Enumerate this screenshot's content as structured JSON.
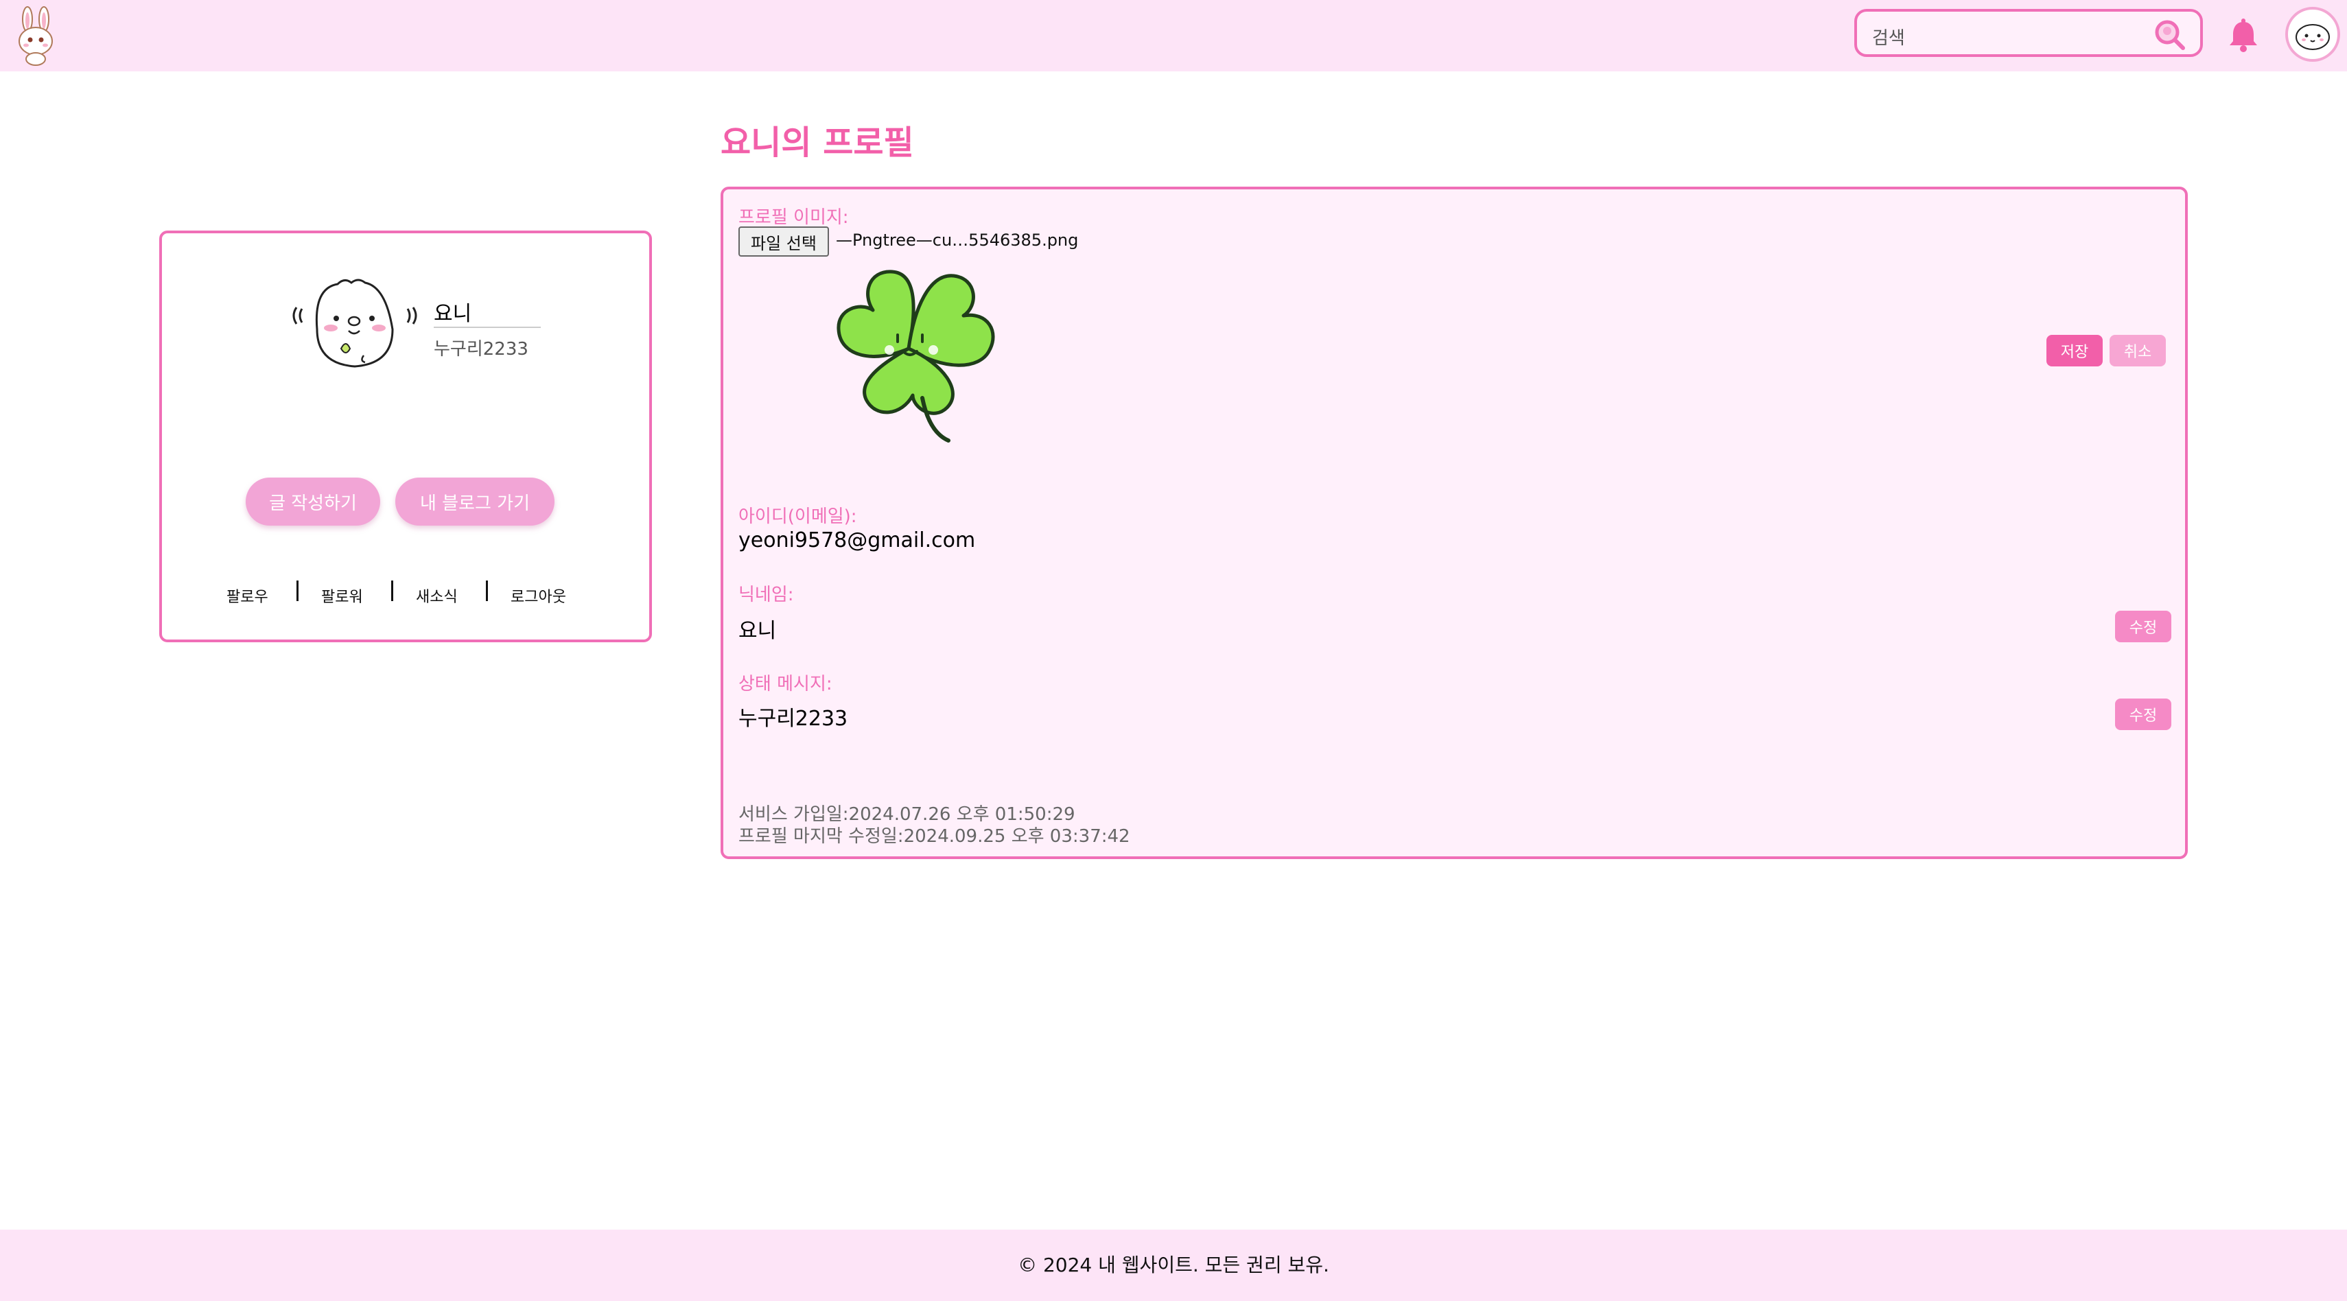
{
  "header": {
    "search_placeholder": "검색"
  },
  "profile_card": {
    "nickname": "요니",
    "status": "누구리2233",
    "write_button": "글 작성하기",
    "blog_button": "내 블로그 가기",
    "links": [
      "팔로우",
      "팔로워",
      "새소식",
      "로그아웃"
    ]
  },
  "page": {
    "title": "요니의 프로필"
  },
  "edit_form": {
    "image_label": "프로필 이미지:",
    "file_button": "파일 선택",
    "file_name": "—Pngtree—cu…5546385.png",
    "save_button": "저장",
    "cancel_button": "취소",
    "id_label": "아이디(이메일):",
    "id_value": "yeoni9578@gmail.com",
    "nickname_label": "닉네임:",
    "nickname_value": "요니",
    "status_label": "상태 메시지:",
    "status_value": "누구리2233",
    "edit_button": "수정",
    "joined": "서비스 가입일:2024.07.26 오후 01:50:29",
    "last_modified": "프로필 마지막 수정일:2024.09.25 오후 03:37:42"
  },
  "footer": {
    "copyright": "© 2024 내 웹사이트. 모든 권리 보유."
  },
  "colors": {
    "accent": "#f06fb7",
    "header_bg": "#fde4f7",
    "button_pink": "#f2a5d6",
    "clover_green": "#8ee24a"
  }
}
